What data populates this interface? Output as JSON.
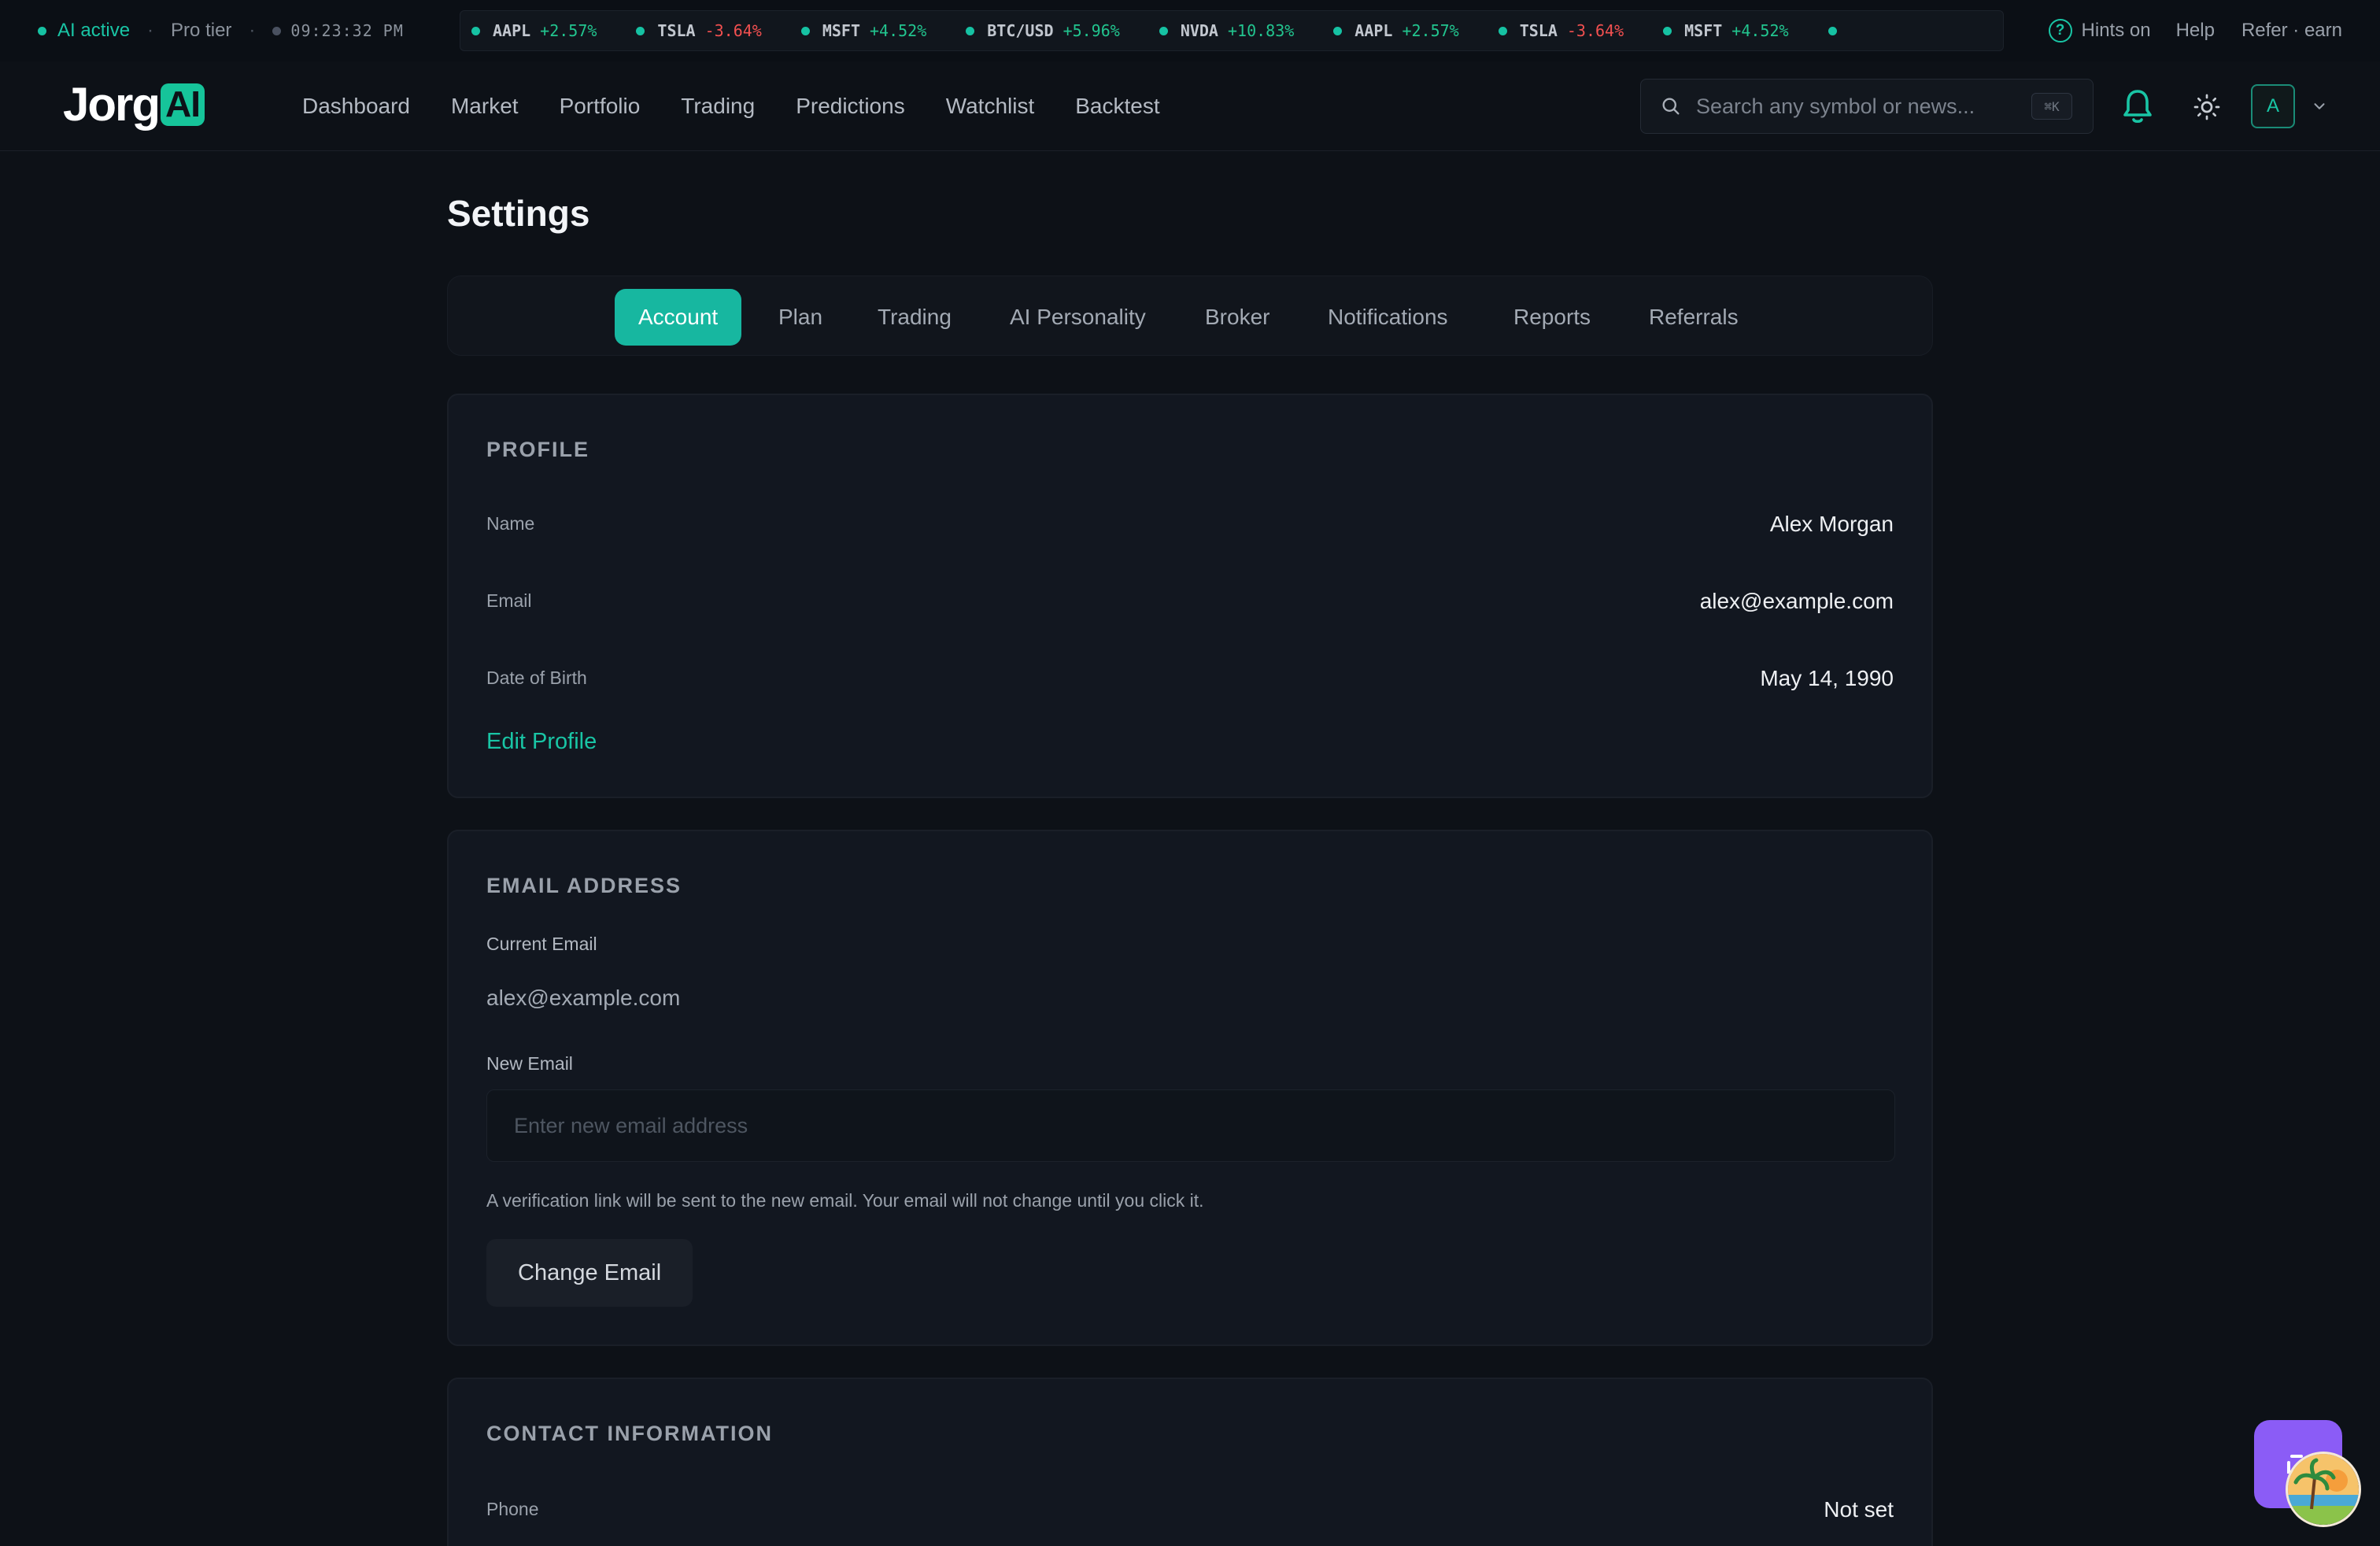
{
  "status": {
    "ai_active": "AI active",
    "tier": "Pro tier",
    "clock": "09:23:32 PM",
    "hints": "Hints on",
    "help": "Help",
    "refer": "Refer · earn",
    "ticker": [
      {
        "symbol": "AAPL",
        "change": "+2.57%",
        "direction": "up"
      },
      {
        "symbol": "TSLA",
        "change": "-3.64%",
        "direction": "down"
      },
      {
        "symbol": "MSFT",
        "change": "+4.52%",
        "direction": "up"
      },
      {
        "symbol": "BTC/USD",
        "change": "+5.96%",
        "direction": "up"
      },
      {
        "symbol": "NVDA",
        "change": "+10.83%",
        "direction": "up"
      },
      {
        "symbol": "AAPL",
        "change": "+2.57%",
        "direction": "up"
      },
      {
        "symbol": "TSLA",
        "change": "-3.64%",
        "direction": "down"
      },
      {
        "symbol": "MSFT",
        "change": "+4.52%",
        "direction": "up"
      }
    ]
  },
  "brand": {
    "name": "Jorg",
    "badge": "AI",
    "accent": "#16c49a"
  },
  "nav": {
    "links": [
      "Dashboard",
      "Market",
      "Portfolio",
      "Trading",
      "Predictions",
      "Watchlist",
      "Backtest"
    ],
    "search_placeholder": "Search any symbol or news...",
    "search_shortcut": "⌘K",
    "avatar_initial": "A",
    "icons": {
      "search": "search-icon",
      "bell": "bell-icon",
      "theme": "sun-icon",
      "menu": "chevron-down-icon"
    }
  },
  "page": {
    "title": "Settings",
    "tabs": [
      "Account",
      "Plan",
      "Trading",
      "AI Personality",
      "Broker",
      "Notifications",
      "Reports",
      "Referrals"
    ],
    "active_tab": "Account"
  },
  "profile": {
    "section_title": "PROFILE",
    "name_label": "Name",
    "name_value": "Alex Morgan",
    "email_label": "Email",
    "email_value": "alex@example.com",
    "dob_label": "Date of Birth",
    "dob_value": "May 14, 1990",
    "edit_link": "Edit Profile"
  },
  "email_section": {
    "section_title": "EMAIL ADDRESS",
    "current_label": "Current Email",
    "current_value": "alex@example.com",
    "new_label": "New Email",
    "new_placeholder": "Enter new email address",
    "new_value": "",
    "hint": "A verification link will be sent to the new email. Your email will not change until you click it.",
    "button": "Change Email"
  },
  "contact": {
    "section_title": "CONTACT INFORMATION",
    "phone_label": "Phone",
    "phone_value": "Not set"
  },
  "colors": {
    "background": "#0d1117",
    "card": "#121720",
    "accent_teal": "#17b7a0",
    "positive": "#22c58f",
    "negative": "#f25050",
    "widget_purple": "#8b5cf6"
  }
}
